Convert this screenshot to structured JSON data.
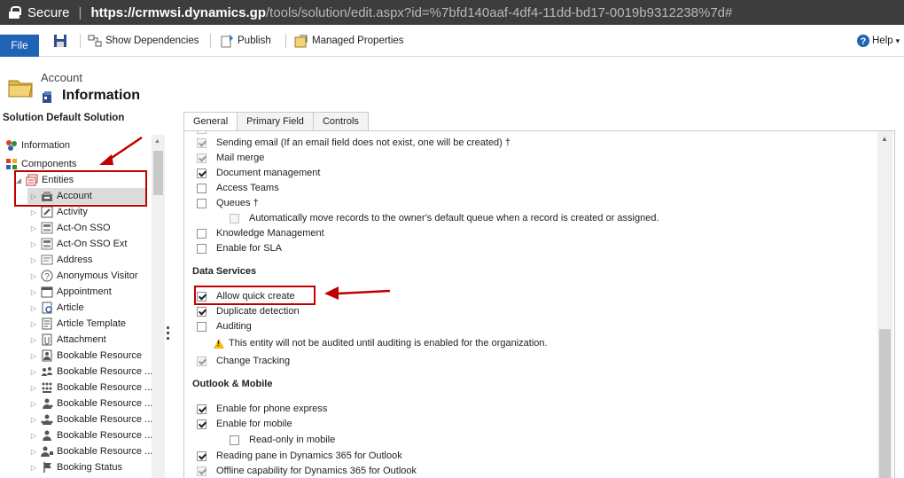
{
  "browser": {
    "secure_label": "Secure",
    "separator": "|",
    "url_host": "https://crmwsi.dynamics.gp",
    "url_path": "/tools/solution/edit.aspx?id=%7bfd140aaf-4df4-11dd-bd17-0019b9312238%7d#"
  },
  "ribbon": {
    "file_label": "File",
    "show_dependencies_label": "Show Dependencies",
    "publish_label": "Publish",
    "managed_properties_label": "Managed Properties",
    "help_label": "Help",
    "help_caret": "▾"
  },
  "header": {
    "entity_name": "Account",
    "page_title": "Information"
  },
  "nav": {
    "solution_title": "Solution Default Solution",
    "items": [
      {
        "label": "Information"
      },
      {
        "label": "Components"
      },
      {
        "label": "Entities"
      },
      {
        "label": "Account"
      },
      {
        "label": "Activity"
      },
      {
        "label": "Act-On SSO"
      },
      {
        "label": "Act-On SSO Ext"
      },
      {
        "label": "Address"
      },
      {
        "label": "Anonymous Visitor"
      },
      {
        "label": "Appointment"
      },
      {
        "label": "Article"
      },
      {
        "label": "Article Template"
      },
      {
        "label": "Attachment"
      },
      {
        "label": "Bookable Resource"
      },
      {
        "label": "Bookable Resource ..."
      },
      {
        "label": "Bookable Resource ..."
      },
      {
        "label": "Bookable Resource ..."
      },
      {
        "label": "Bookable Resource ..."
      },
      {
        "label": "Bookable Resource ..."
      },
      {
        "label": "Bookable Resource ..."
      },
      {
        "label": "Booking Status"
      }
    ]
  },
  "tabs": [
    {
      "label": "General"
    },
    {
      "label": "Primary Field"
    },
    {
      "label": "Controls"
    }
  ],
  "form": {
    "options_top": [
      {
        "label": "Sending email (If an email field does not exist, one will be created) †",
        "checked": true,
        "disabled": true
      },
      {
        "label": "Mail merge",
        "checked": true,
        "disabled": true
      },
      {
        "label": "Document management",
        "checked": true,
        "disabled": false
      },
      {
        "label": "Access Teams",
        "checked": false,
        "disabled": false
      },
      {
        "label": "Queues †",
        "checked": false,
        "disabled": false
      },
      {
        "label": "Automatically move records to the owner's default queue when a record is created or assigned.",
        "checked": false,
        "disabled": true
      },
      {
        "label": "Knowledge Management",
        "checked": false,
        "disabled": false
      },
      {
        "label": "Enable for SLA",
        "checked": false,
        "disabled": false
      }
    ],
    "data_services_title": "Data Services",
    "data_services": [
      {
        "label": "Allow quick create",
        "checked": true,
        "disabled": false
      },
      {
        "label": "Duplicate detection",
        "checked": true,
        "disabled": false
      },
      {
        "label": "Auditing",
        "checked": false,
        "disabled": false
      }
    ],
    "audit_warning": "This entity will not be audited until auditing is enabled for the organization.",
    "change_tracking": {
      "label": "Change Tracking",
      "checked": true,
      "disabled": true
    },
    "outlook_title": "Outlook & Mobile",
    "outlook": [
      {
        "label": "Enable for phone express",
        "checked": true,
        "disabled": false
      },
      {
        "label": "Enable for mobile",
        "checked": true,
        "disabled": false
      },
      {
        "label": "Read-only in mobile",
        "checked": false,
        "disabled": false
      },
      {
        "label": "Reading pane in Dynamics 365 for Outlook",
        "checked": true,
        "disabled": false
      },
      {
        "label": "Offline capability for Dynamics 365 for Outlook",
        "checked": true,
        "disabled": true
      }
    ]
  },
  "colors": {
    "file_button": "#1e63b6",
    "annotation_red": "#c00000",
    "address_bar": "#3d3d3d"
  }
}
